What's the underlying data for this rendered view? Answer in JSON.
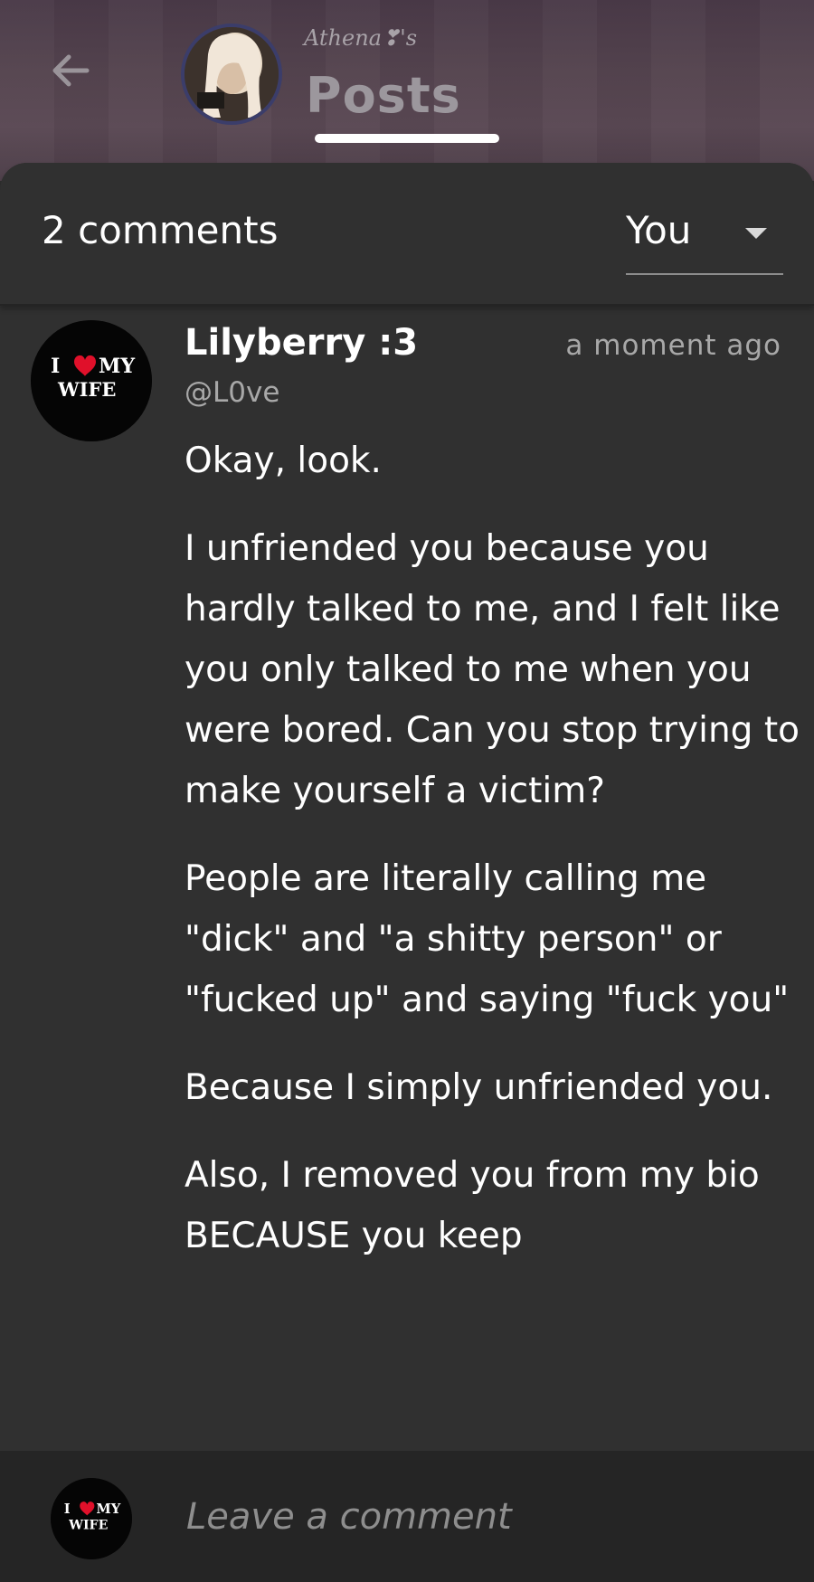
{
  "header": {
    "owner_name": "Athena❣'s",
    "title": "Posts",
    "back_icon": "arrow-left-icon"
  },
  "comments_panel": {
    "count_label": "2 comments",
    "sort": {
      "selected": "You",
      "icon": "chevron-down-icon"
    }
  },
  "comment": {
    "author": "Lilyberry :3",
    "handle": "@L0ve",
    "time": "a moment ago",
    "avatar_badge": {
      "line1_left": "I",
      "line1_right": "MY",
      "line2": "WIFE",
      "heart_color": "#e0102a"
    },
    "paragraphs": [
      "Okay, look.",
      "I unfriended you because you hardly talked to me, and I felt like you only talked to me when you were bored. Can you stop trying to make yourself a victim?",
      "People are literally calling me \"dick\" and \"a shitty person\" or \"fucked up\" and saying \"fuck you\"",
      "Because I simply unfriended you.",
      "Also, I removed you from my bio BECAUSE you keep"
    ]
  },
  "composer": {
    "placeholder": "Leave a comment"
  }
}
